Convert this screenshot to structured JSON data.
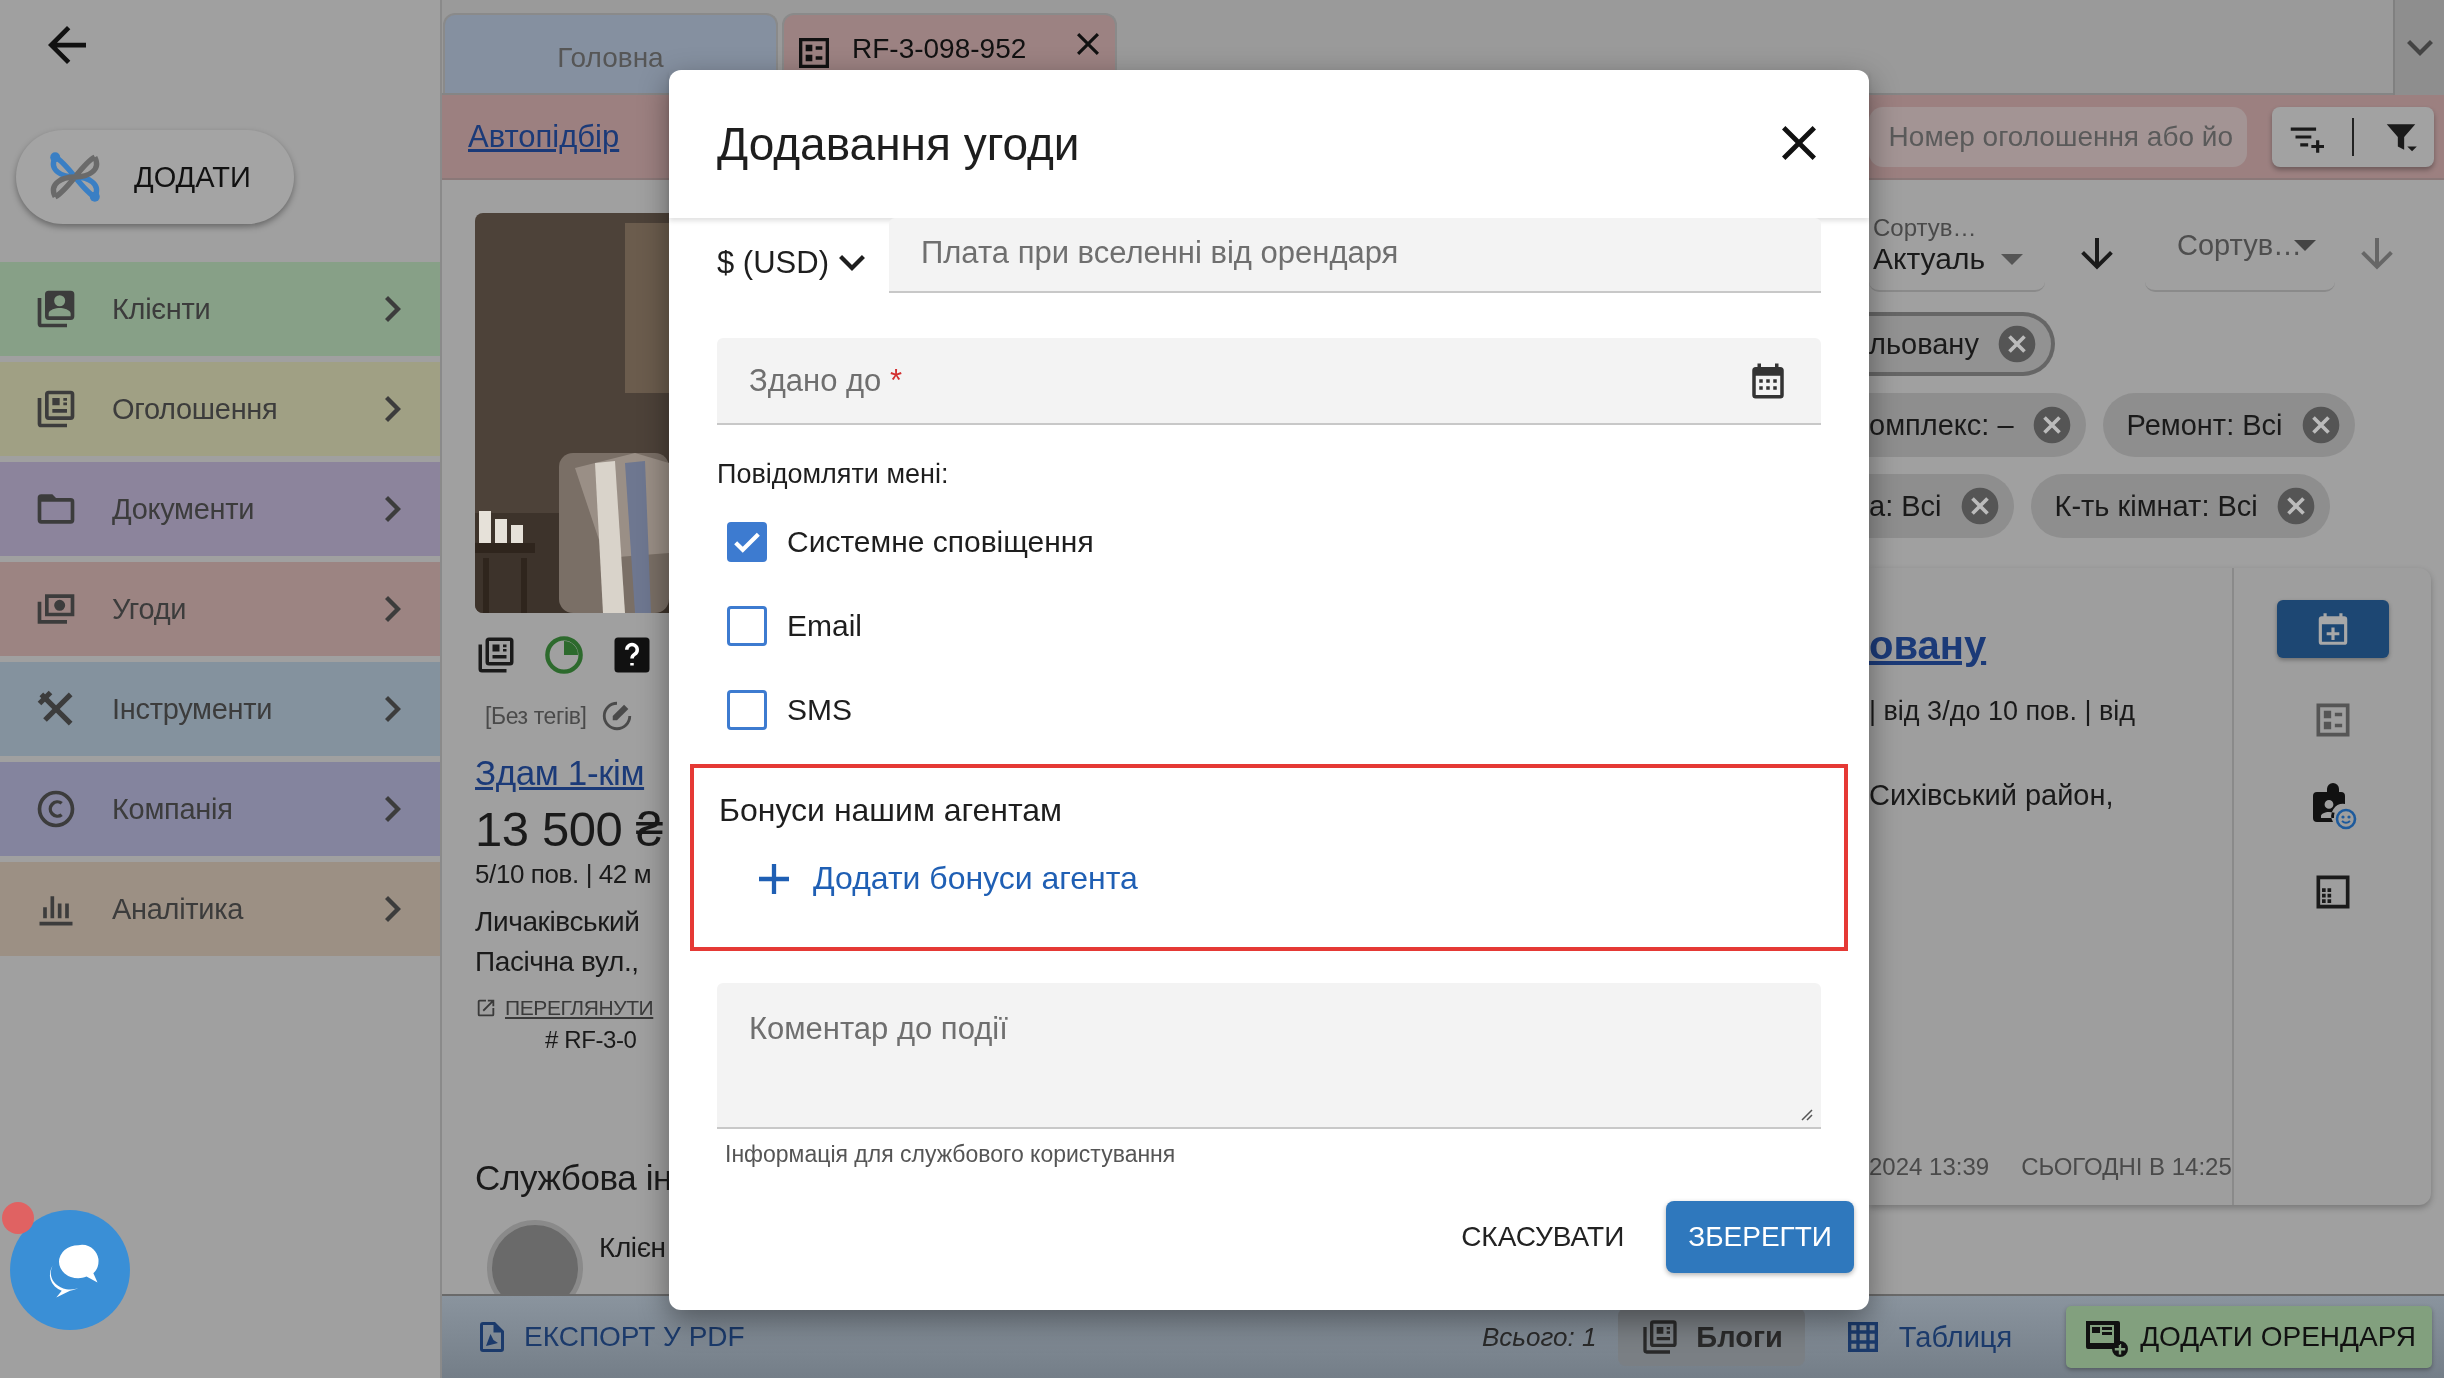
{
  "sidebar": {
    "add_button": "ДОДАТИ",
    "items": [
      {
        "label": "Клієнти",
        "color": "#87a087"
      },
      {
        "label": "Оголошення",
        "color": "#a0a084"
      },
      {
        "label": "Документи",
        "color": "#8c849c"
      },
      {
        "label": "Угоди",
        "color": "#9c8482"
      },
      {
        "label": "Інструменти",
        "color": "#84929e"
      },
      {
        "label": "Компанія",
        "color": "#84849e"
      },
      {
        "label": "Аналітика",
        "color": "#9c9084"
      }
    ]
  },
  "tabs": [
    {
      "label": "Головна",
      "selected": false
    },
    {
      "label": "RF-3-098-952",
      "selected": true
    }
  ],
  "toolbar": {
    "link": "Автопідбір",
    "search_placeholder": "Номер оголошення або йо"
  },
  "listing": {
    "tags": "[Без тегів]",
    "title": "Здам 1-кім",
    "price": "13 500 ₴",
    "details": "5/10 пов. | 42 м",
    "address": [
      "Личаківський",
      "Пасічна вул.,"
    ],
    "view_link": "ПЕРЕГЛЯНУТИ",
    "code": "# RF-3-0",
    "section_title": "Службова ін",
    "client_label": "Клієн"
  },
  "sorting": [
    {
      "label": "Сортув…",
      "value": "Актуаль"
    },
    {
      "placeholder": "Сортув…"
    }
  ],
  "filter_chips": [
    [
      {
        "label": "льовану",
        "selected": true
      }
    ],
    [
      {
        "label": "омплекс: –",
        "selected": false
      },
      {
        "label": "Ремонт: Всі",
        "selected": false
      }
    ],
    [
      {
        "label": "а: Всі",
        "selected": false
      },
      {
        "label": "К-ть кімнат: Всі",
        "selected": false
      }
    ]
  ],
  "request_card": {
    "title": "овану",
    "details": "| від 3/до 10 пов. | від",
    "district": "Сихівський район,",
    "created": "2024 13:39",
    "updated": "СЬОГОДНІ В 14:25"
  },
  "bottom_bar": {
    "export": "ЕКСПОРТ У PDF",
    "total": "Всього: 1",
    "views": [
      {
        "label": "Блоги",
        "selected": true
      },
      {
        "label": "Таблиця",
        "selected": false
      }
    ],
    "add_button": "ДОДАТИ ОРЕНДАРЯ"
  },
  "chat": {
    "unread": true
  },
  "dialog": {
    "title": "Додавання угоди",
    "currency": "$ (USD)",
    "payment_placeholder": "Плата при вселенні від орендаря",
    "date_field": {
      "placeholder": "Здано до",
      "required_mark": "*"
    },
    "notify_label": "Повідомляти мені:",
    "notify_options": [
      {
        "label": "Системне сповіщення",
        "checked": true
      },
      {
        "label": "Email",
        "checked": false
      },
      {
        "label": "SMS",
        "checked": false
      }
    ],
    "bonus_section": {
      "title": "Бонуси нашим агентам",
      "add_link": "Додати бонуси агента",
      "highlighted": true
    },
    "comment": {
      "placeholder": "Коментар до події",
      "helper": "Інформація для службового користування"
    },
    "buttons": [
      {
        "label": "СКАСУВАТИ",
        "kind": "text"
      },
      {
        "label": "ЗБЕРЕГТИ",
        "kind": "primary"
      }
    ]
  }
}
